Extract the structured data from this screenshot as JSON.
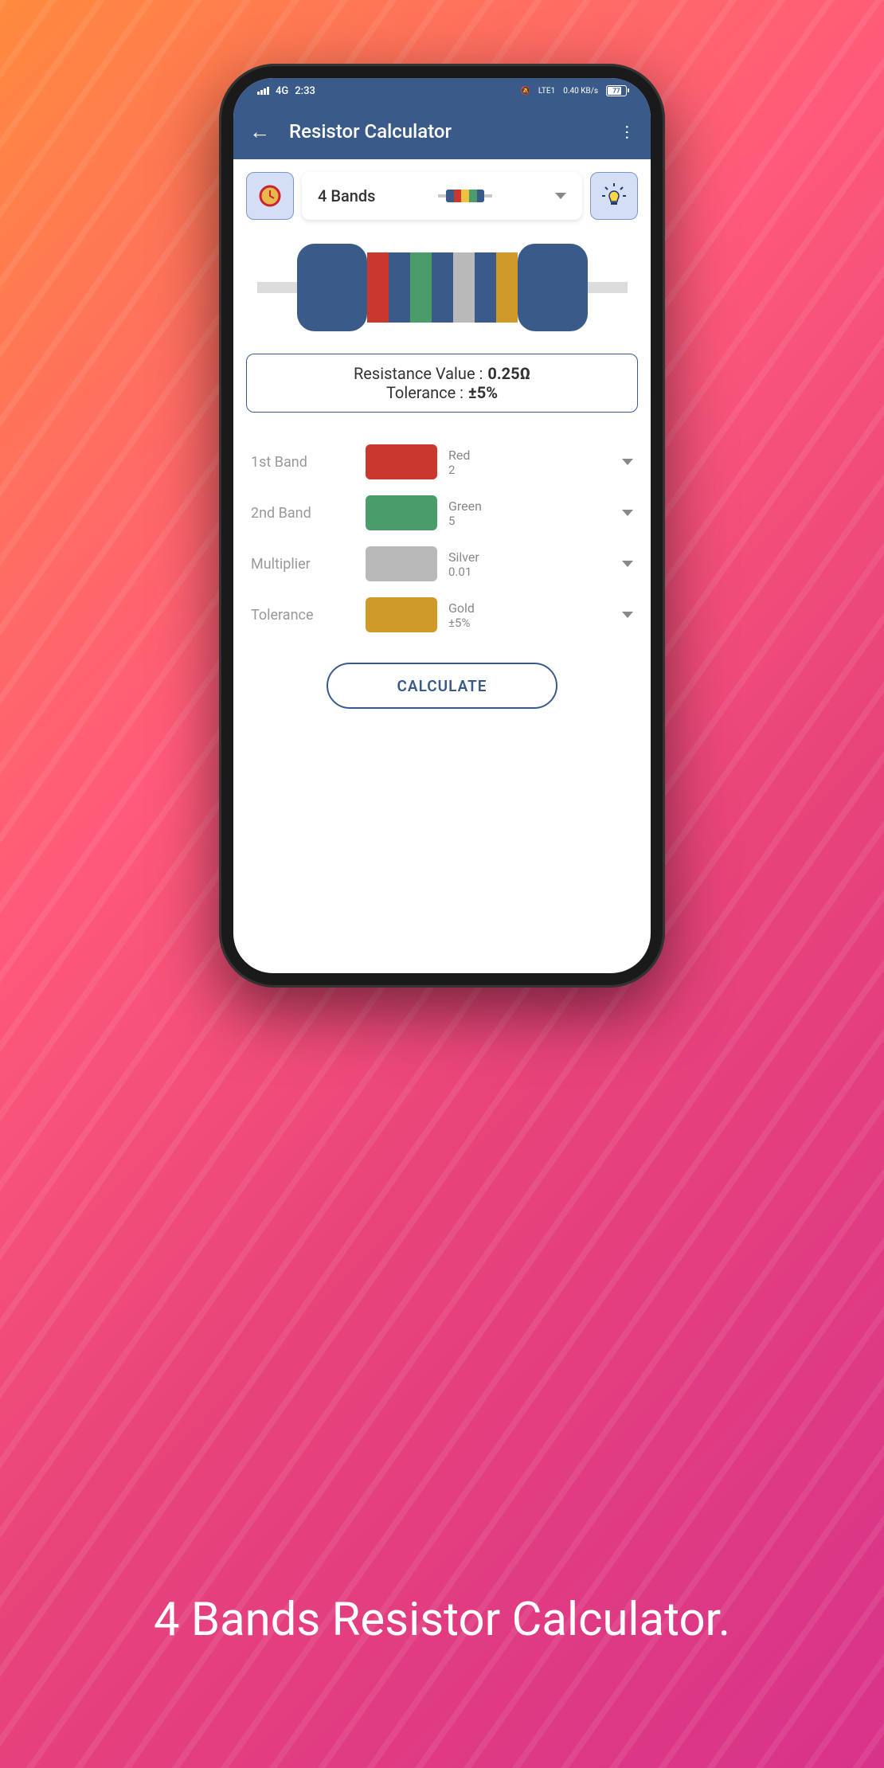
{
  "statusBar": {
    "time": "2:33",
    "network": "4G",
    "lte": "LTE1",
    "speed": "0.40 KB/s",
    "batteryPercent": "77"
  },
  "appBar": {
    "title": "Resistor Calculator"
  },
  "bandSelector": {
    "label": "4 Bands"
  },
  "resistorBandColors": [
    "#c9372e",
    "#3a5b8a",
    "#4a9d6a",
    "#3a5b8a",
    "#b9b9b9",
    "#3a5b8a",
    "#d09a2a"
  ],
  "result": {
    "resistanceLabel": "Resistance Value :",
    "resistanceValue": "0.25Ω",
    "toleranceLabel": "Tolerance :",
    "toleranceValue": "±5%"
  },
  "bands": [
    {
      "label": "1st Band",
      "colorName": "Red",
      "colorValue": "2",
      "swatch": "#c9372e"
    },
    {
      "label": "2nd Band",
      "colorName": "Green",
      "colorValue": "5",
      "swatch": "#4a9d6a"
    },
    {
      "label": "Multiplier",
      "colorName": "Silver",
      "colorValue": "0.01",
      "swatch": "#b9b9b9"
    },
    {
      "label": "Tolerance",
      "colorName": "Gold",
      "colorValue": "±5%",
      "swatch": "#d09a2a"
    }
  ],
  "calculateButton": "CALCULATE",
  "promo": "4 Bands Resistor Calculator."
}
